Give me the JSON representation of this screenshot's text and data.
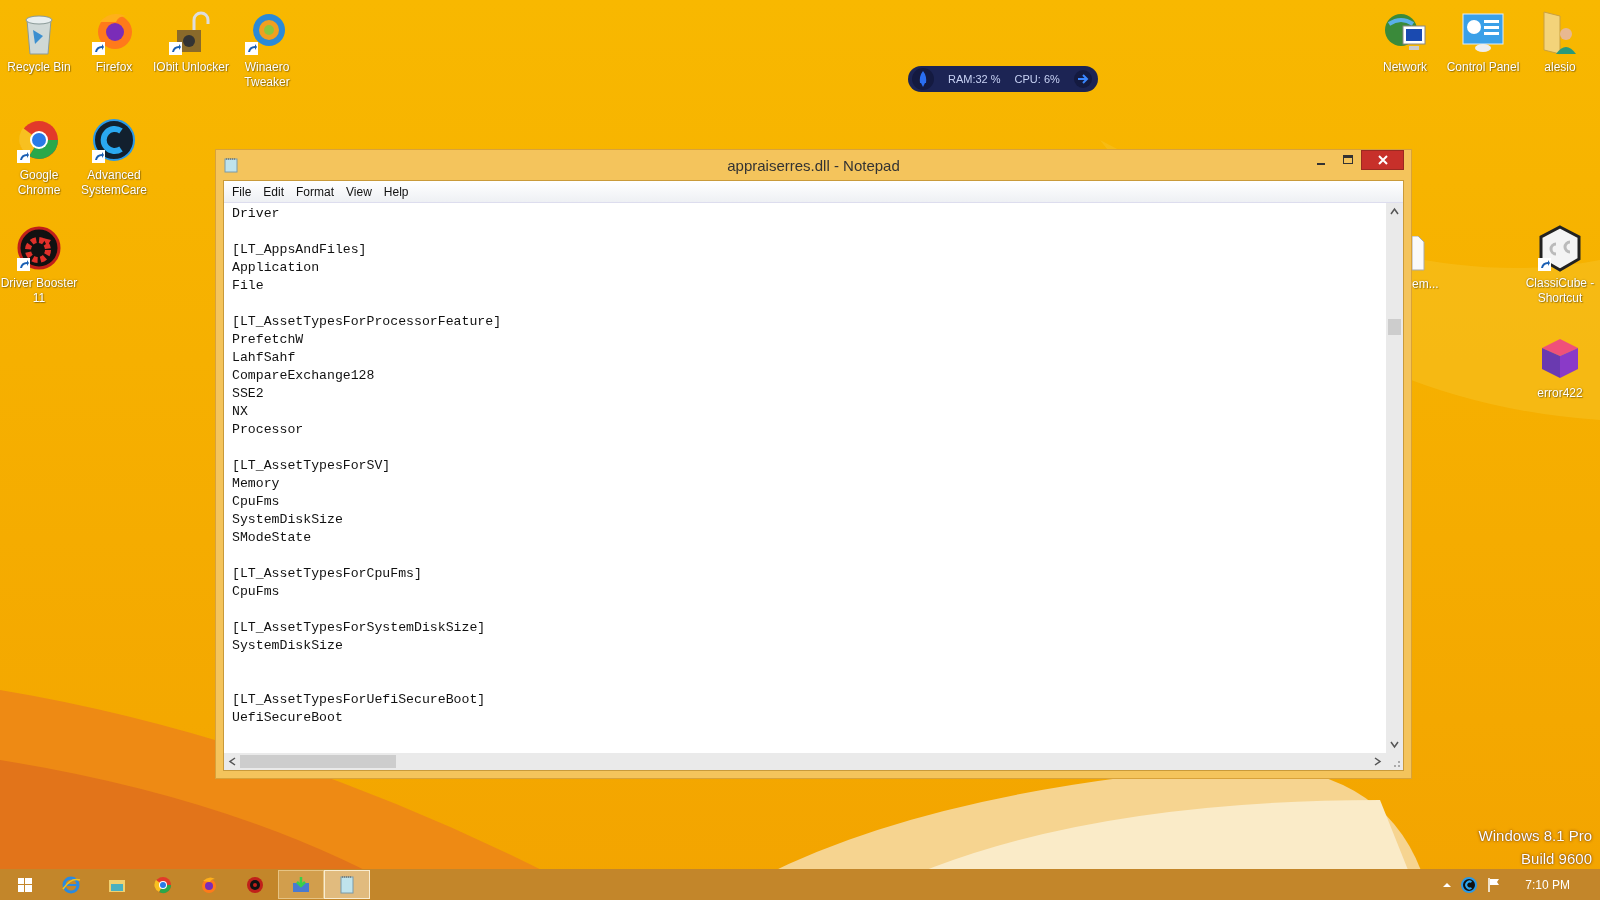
{
  "desktop_icons": [
    {
      "label": "Recycle Bin",
      "shortcut": false
    },
    {
      "label": "Firefox",
      "shortcut": true
    },
    {
      "label": "IObit Unlocker",
      "shortcut": true
    },
    {
      "label": "Winaero Tweaker",
      "shortcut": true
    },
    {
      "label": "Network",
      "shortcut": false
    },
    {
      "label": "Control Panel",
      "shortcut": false
    },
    {
      "label": "alesio",
      "shortcut": false
    },
    {
      "label": "Google Chrome",
      "shortcut": true
    },
    {
      "label": "Advanced SystemCare",
      "shortcut": true
    },
    {
      "label": "Driver Booster 11",
      "shortcut": true
    },
    {
      "label": "em..."
    },
    {
      "label": "ClassiCube - Shortcut",
      "shortcut": true
    },
    {
      "label": "error422",
      "shortcut": false
    }
  ],
  "system_monitor": {
    "ram": "RAM:32 %",
    "cpu": "CPU: 6%"
  },
  "window": {
    "title": "appraiserres.dll - Notepad",
    "menu": [
      "File",
      "Edit",
      "Format",
      "View",
      "Help"
    ],
    "lines": [
      {
        "kind": "text",
        "text": "Driver"
      },
      {
        "kind": "blank"
      },
      {
        "kind": "text",
        "text": "[LT_AppsAndFiles]"
      },
      {
        "kind": "text",
        "text": "Application"
      },
      {
        "kind": "text",
        "text": "File"
      },
      {
        "kind": "blank"
      },
      {
        "kind": "text",
        "text": "[LT_AssetTypesForProcessorFeature]"
      },
      {
        "kind": "text",
        "text": "PrefetchW"
      },
      {
        "kind": "text",
        "text": "LahfSahf"
      },
      {
        "kind": "text",
        "text": "CompareExchange128"
      },
      {
        "kind": "text",
        "text": "SSE2"
      },
      {
        "kind": "text",
        "text": "NX"
      },
      {
        "kind": "text",
        "text": "Processor"
      },
      {
        "kind": "blank"
      },
      {
        "kind": "text",
        "text": "[LT_AssetTypesForSV]"
      },
      {
        "kind": "text",
        "text": "Memory"
      },
      {
        "kind": "text",
        "text": "CpuFms"
      },
      {
        "kind": "text",
        "text": "SystemDiskSize"
      },
      {
        "kind": "text",
        "text": "SModeState"
      },
      {
        "kind": "blank"
      },
      {
        "kind": "text",
        "text": "[LT_AssetTypesForCpuFms]"
      },
      {
        "kind": "text",
        "text": "CpuFms"
      },
      {
        "kind": "blank"
      },
      {
        "kind": "text",
        "text": "[LT_AssetTypesForSystemDiskSize]"
      },
      {
        "kind": "text",
        "text": "SystemDiskSize"
      },
      {
        "kind": "blank"
      },
      {
        "kind": "blank"
      },
      {
        "kind": "text",
        "text": "[LT_AssetTypesForUefiSecureBoot]"
      },
      {
        "kind": "text",
        "text": "UefiSecureBoot"
      }
    ]
  },
  "os_watermark": [
    "Windows 8.1 Pro",
    "Build 9600"
  ],
  "taskbar": {
    "items": [
      {
        "open": false,
        "selected": false
      },
      {
        "open": false,
        "selected": false
      },
      {
        "open": false,
        "selected": false
      },
      {
        "open": false,
        "selected": false
      },
      {
        "open": false,
        "selected": false
      },
      {
        "open": true,
        "selected": false
      },
      {
        "open": true,
        "selected": true
      }
    ],
    "clock": "7:10 PM"
  }
}
